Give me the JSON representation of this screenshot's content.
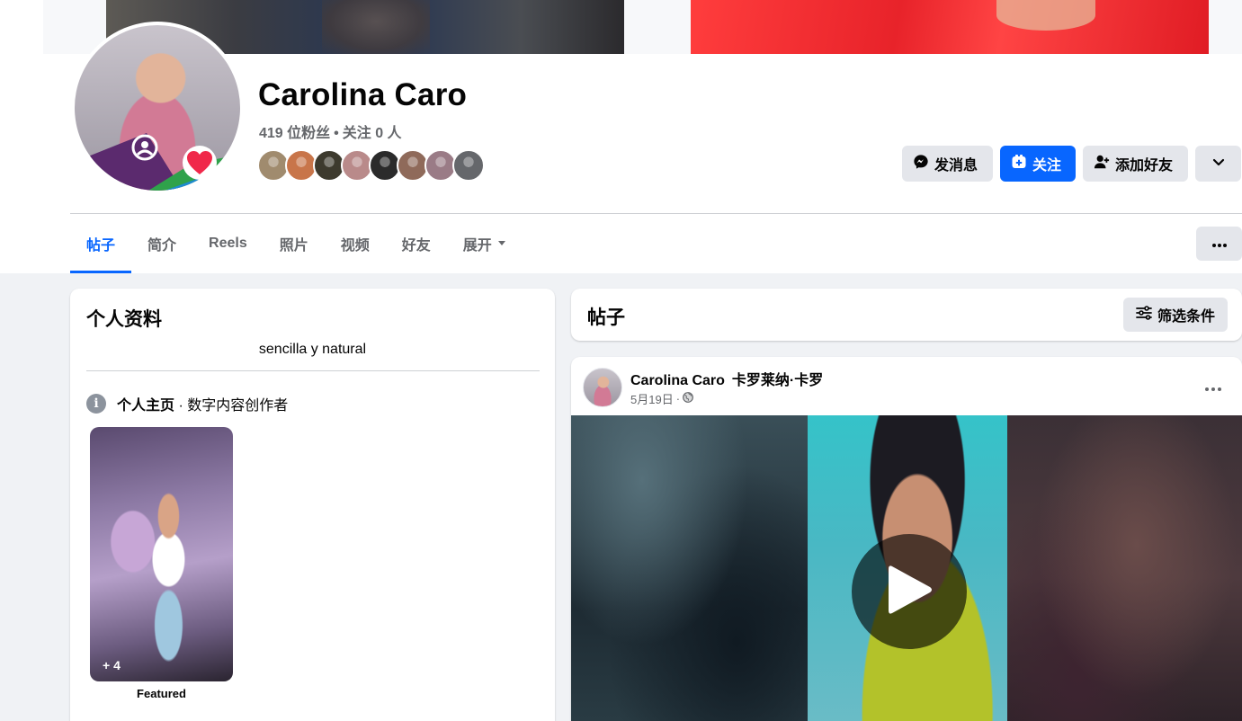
{
  "profile": {
    "name": "Carolina Caro",
    "followers_text": "419 位粉丝",
    "separator": "•",
    "following_text": "关注 0 人",
    "friend_avatars": [
      {
        "name": "friend-avatar-1",
        "color": "#a08b6e"
      },
      {
        "name": "friend-avatar-2",
        "color": "#c8754a"
      },
      {
        "name": "friend-avatar-3",
        "color": "#3d3a2e"
      },
      {
        "name": "friend-avatar-4",
        "color": "#b98a8a"
      },
      {
        "name": "friend-avatar-5",
        "color": "#2b2b2b"
      },
      {
        "name": "friend-avatar-6",
        "color": "#8f6a5a"
      },
      {
        "name": "friend-avatar-7",
        "color": "#9a7b86"
      },
      {
        "name": "friend-avatar-8",
        "color": "#65676b"
      }
    ]
  },
  "actions": {
    "message_label": "发消息",
    "follow_label": "关注",
    "add_friend_label": "添加好友"
  },
  "tabs": [
    {
      "label": "帖子",
      "active": true
    },
    {
      "label": "简介",
      "active": false
    },
    {
      "label": "Reels",
      "active": false
    },
    {
      "label": "照片",
      "active": false
    },
    {
      "label": "视频",
      "active": false
    },
    {
      "label": "好友",
      "active": false
    },
    {
      "label": "展开",
      "active": false
    }
  ],
  "intro": {
    "title": "个人资料",
    "bio": "sencilla y natural",
    "page_label": "个人主页",
    "page_category": " · 数字内容创作者",
    "featured_count": "+ 4",
    "featured_label": "Featured"
  },
  "posts": {
    "title": "帖子",
    "filter_label": "筛选条件",
    "post": {
      "author": "Carolina Caro",
      "author_alt": "卡罗莱纳·卡罗",
      "date": "5月19日",
      "dot": "·",
      "privacy_icon": "globe-icon"
    }
  },
  "colors": {
    "accent": "#0866ff",
    "secondary_button": "#e4e6eb",
    "muted_text": "#65676b",
    "background": "#f0f2f5"
  }
}
